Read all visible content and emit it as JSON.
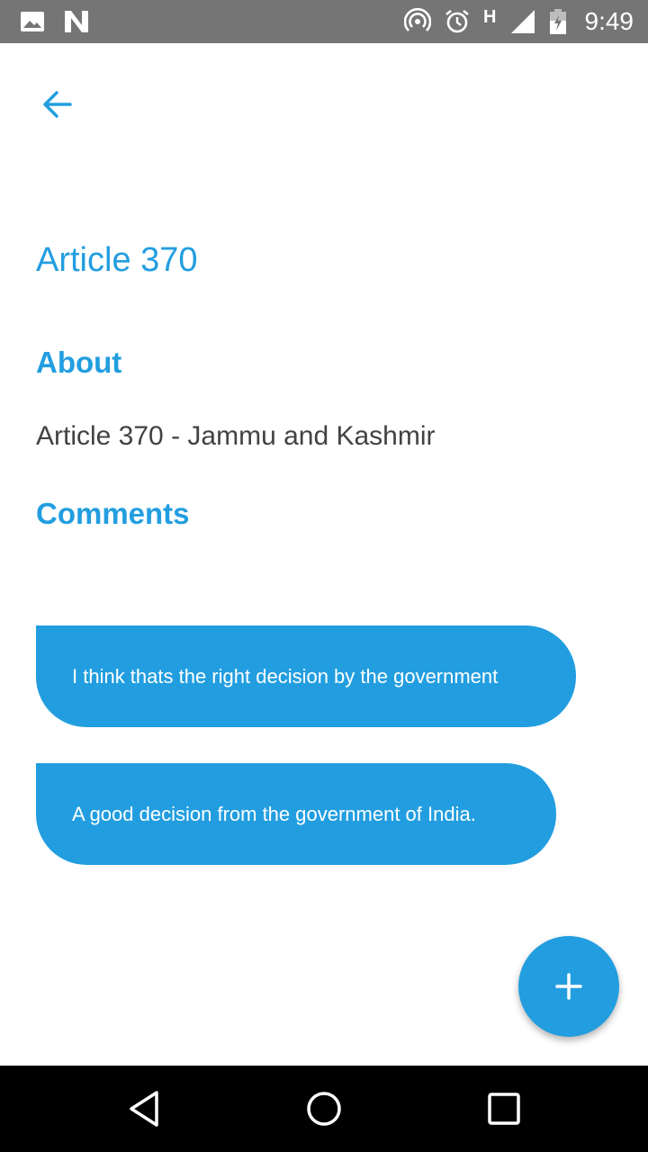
{
  "status_bar": {
    "time": "9:49",
    "network_type": "H",
    "icons": [
      "image-icon",
      "n-logo-icon",
      "hotspot-icon",
      "alarm-icon",
      "signal-icon",
      "battery-icon"
    ]
  },
  "toolbar": {
    "back_icon": "arrow-left-icon"
  },
  "page": {
    "title": "Article 370",
    "about_heading": "About",
    "about_text": "Article 370 - Jammu and Kashmir",
    "comments_heading": "Comments"
  },
  "comments": [
    {
      "text": "I think thats the right decision by the government"
    },
    {
      "text": "A good decision from the government of India."
    }
  ],
  "fab": {
    "icon": "plus-icon"
  },
  "nav_bar": {
    "icons": [
      "nav-back-icon",
      "nav-home-icon",
      "nav-recents-icon"
    ]
  },
  "colors": {
    "accent": "#229ee0",
    "status_bar": "#757575",
    "text_dark": "#424242",
    "nav_bar": "#000000"
  }
}
